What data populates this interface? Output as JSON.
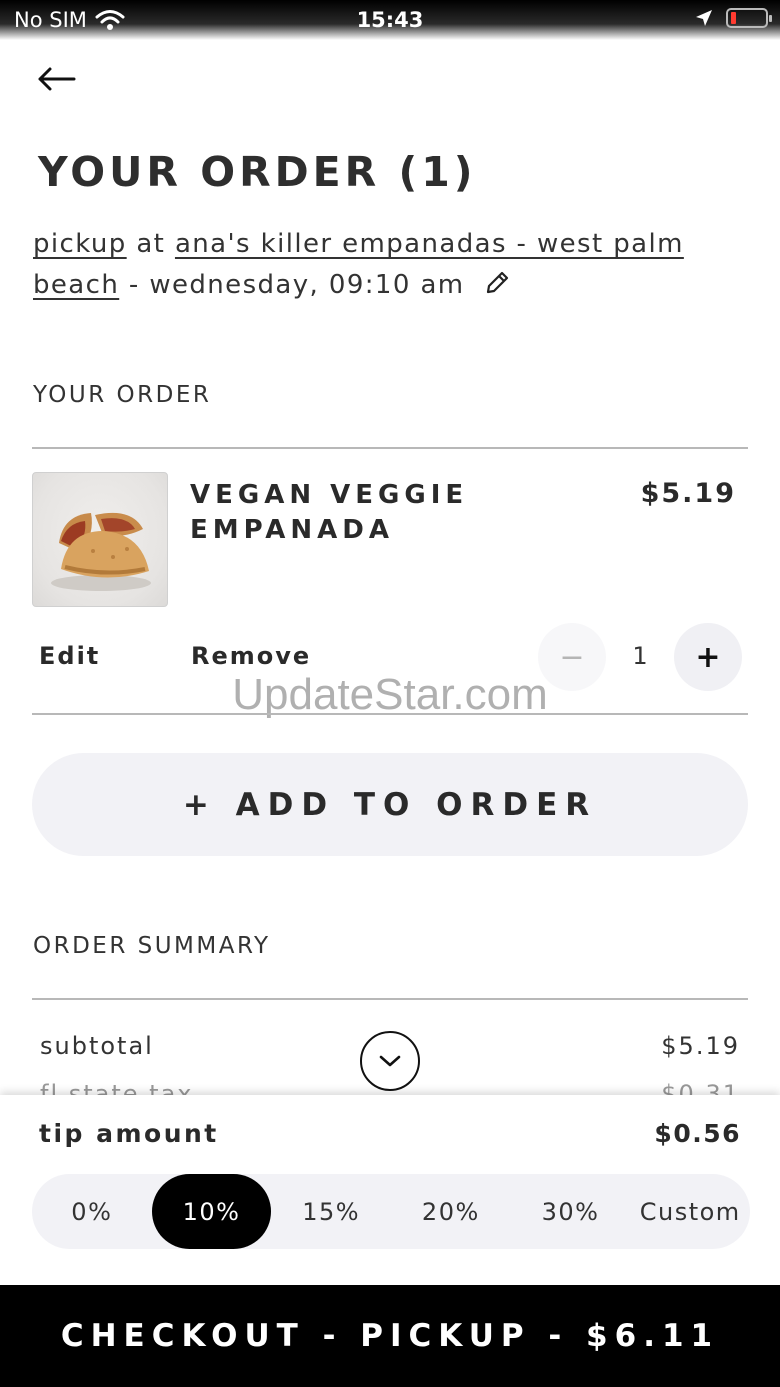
{
  "status_bar": {
    "carrier": "No SIM",
    "time": "15:43"
  },
  "header": {
    "title": "YOUR ORDER (1)"
  },
  "pickup": {
    "mode": "pickup",
    "at": "at",
    "location": "ana's killer empanadas - west palm beach",
    "when": "- wednesday, 09:10 am"
  },
  "order": {
    "section_label": "YOUR ORDER",
    "items": [
      {
        "name": "VEGAN VEGGIE EMPANADA",
        "price": "$5.19",
        "edit_label": "Edit",
        "remove_label": "Remove",
        "quantity": "1",
        "minus": "−",
        "plus": "+"
      }
    ],
    "add_button": "+ ADD TO ORDER"
  },
  "watermark": "UpdateStar.com",
  "summary": {
    "section_label": "ORDER SUMMARY",
    "rows": [
      {
        "label": "subtotal",
        "value": "$5.19"
      },
      {
        "label": "fl state tax",
        "value": "$0.31"
      }
    ]
  },
  "tip": {
    "label": "tip amount",
    "value": "$0.56",
    "options": [
      "0%",
      "10%",
      "15%",
      "20%",
      "30%",
      "Custom"
    ],
    "selected": "10%"
  },
  "checkout": {
    "label": "CHECKOUT - PICKUP - $6.11"
  },
  "icons": {
    "back": "arrow-left-icon",
    "edit": "pencil-icon",
    "collapse": "chevron-down-icon",
    "wifi": "wifi-icon",
    "location": "location-arrow-icon",
    "battery": "battery-icon"
  },
  "colors": {
    "checkout_bg": "#000000",
    "battery_low": "#ff3b30",
    "tip_selected": "#000000"
  }
}
